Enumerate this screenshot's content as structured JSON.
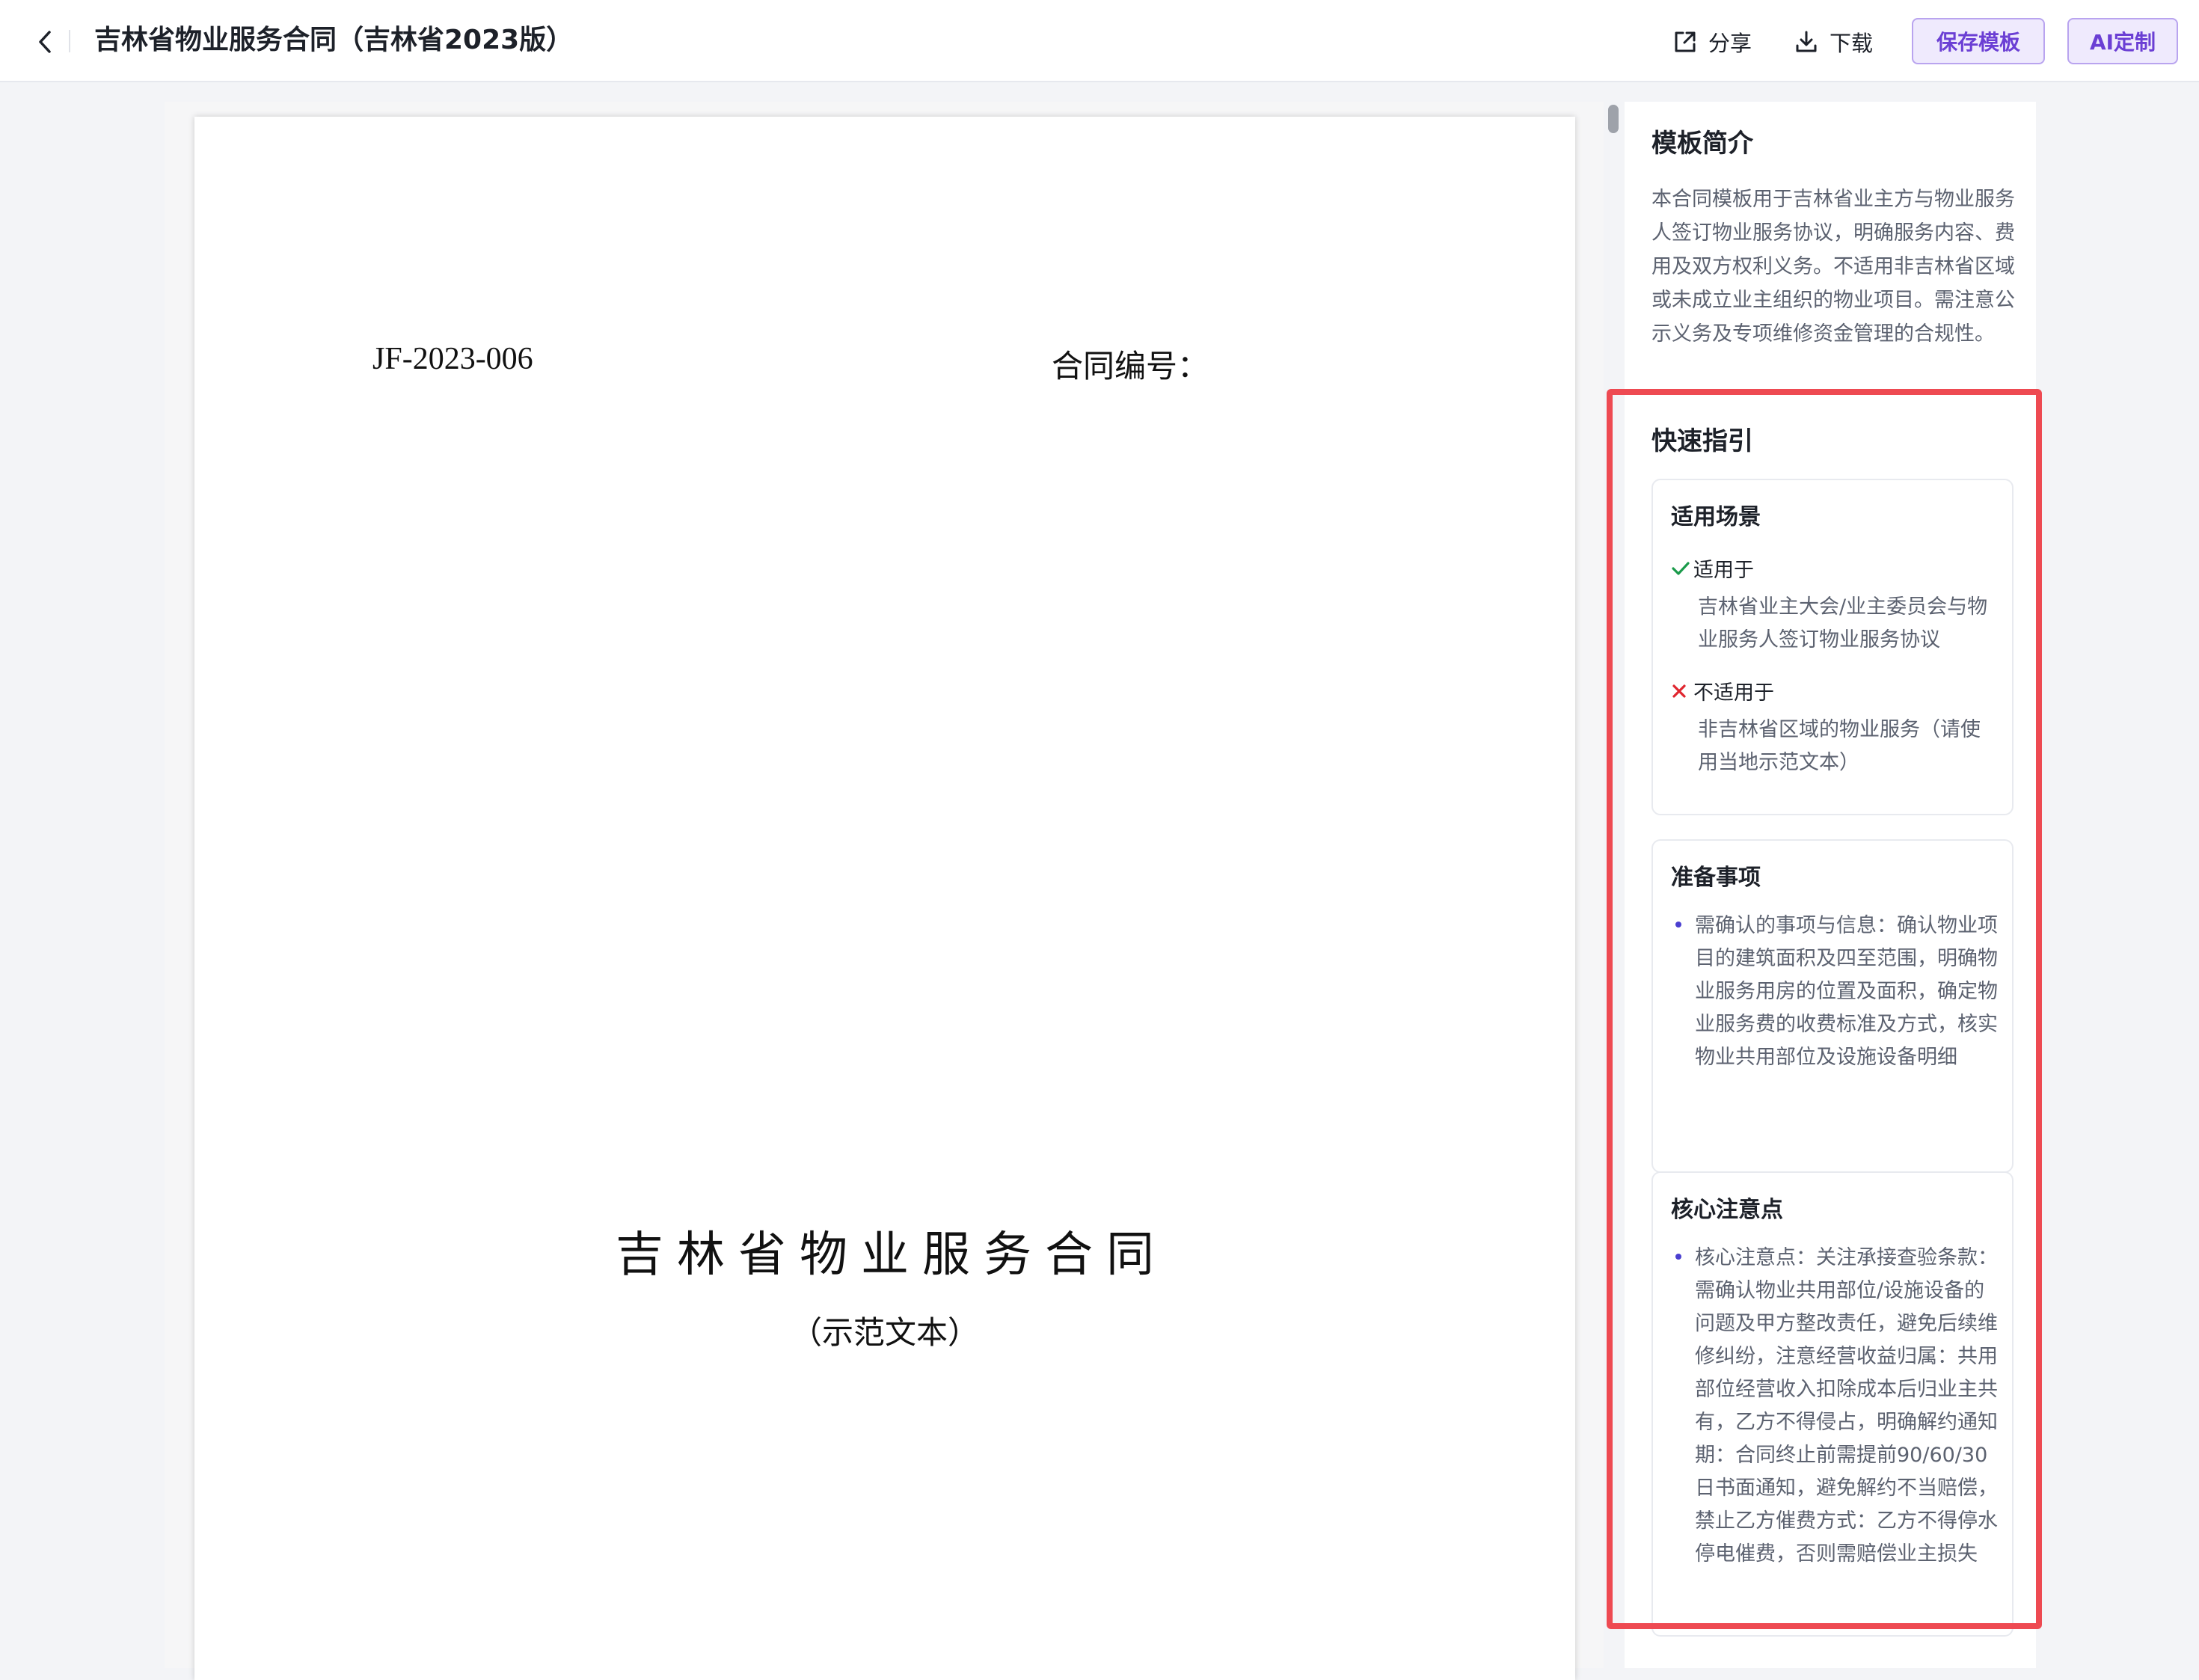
{
  "header": {
    "title": "吉林省物业服务合同（吉林省2023版）",
    "share_label": "分享",
    "download_label": "下载",
    "save_template_label": "保存模板",
    "ai_custom_label": "AI定制"
  },
  "document": {
    "code": "JF-2023-006",
    "contract_number_label": "合同编号：",
    "title": "吉林省物业服务合同",
    "subtitle": "（示范文本）"
  },
  "side_panel": {
    "intro_title": "模板简介",
    "intro_text": "本合同模板用于吉林省业主方与物业服务人签订物业服务协议，明确服务内容、费用及双方权利义务。不适用非吉林省区域或未成立业主组织的物业项目。需注意公示义务及专项维修资金管理的合规性。",
    "quick_guide_title": "快速指引",
    "scenario": {
      "title": "适用场景",
      "applicable_label": "适用于",
      "applicable_text": "吉林省业主大会/业主委员会与物业服务人签订物业服务协议",
      "not_applicable_label": "不适用于",
      "not_applicable_text": "非吉林省区域的物业服务（请使用当地示范文本）"
    },
    "preparation": {
      "title": "准备事项",
      "text": "需确认的事项与信息：确认物业项目的建筑面积及四至范围，明确物业服务用房的位置及面积，确定物业服务费的收费标准及方式，核实物业共用部位及设施设备明细"
    },
    "core_points": {
      "title": "核心注意点",
      "text": "核心注意点：关注承接查验条款：需确认物业共用部位/设施设备的问题及甲方整改责任，避免后续维修纠纷，注意经营收益归属：共用部位经营收入扣除成本后归业主共有，乙方不得侵占，明确解约通知期：合同终止前需提前90/60/30日书面通知，避免解约不当赔偿，禁止乙方催费方式：乙方不得停水停电催费，否则需赔偿业主损失"
    }
  },
  "colors": {
    "accent": "#6b3fd4",
    "accent_bg": "#efeafd",
    "highlight": "#ee4a52",
    "check": "#1a9a4a",
    "cross": "#e0262f",
    "bullet": "#4a3fd0"
  }
}
